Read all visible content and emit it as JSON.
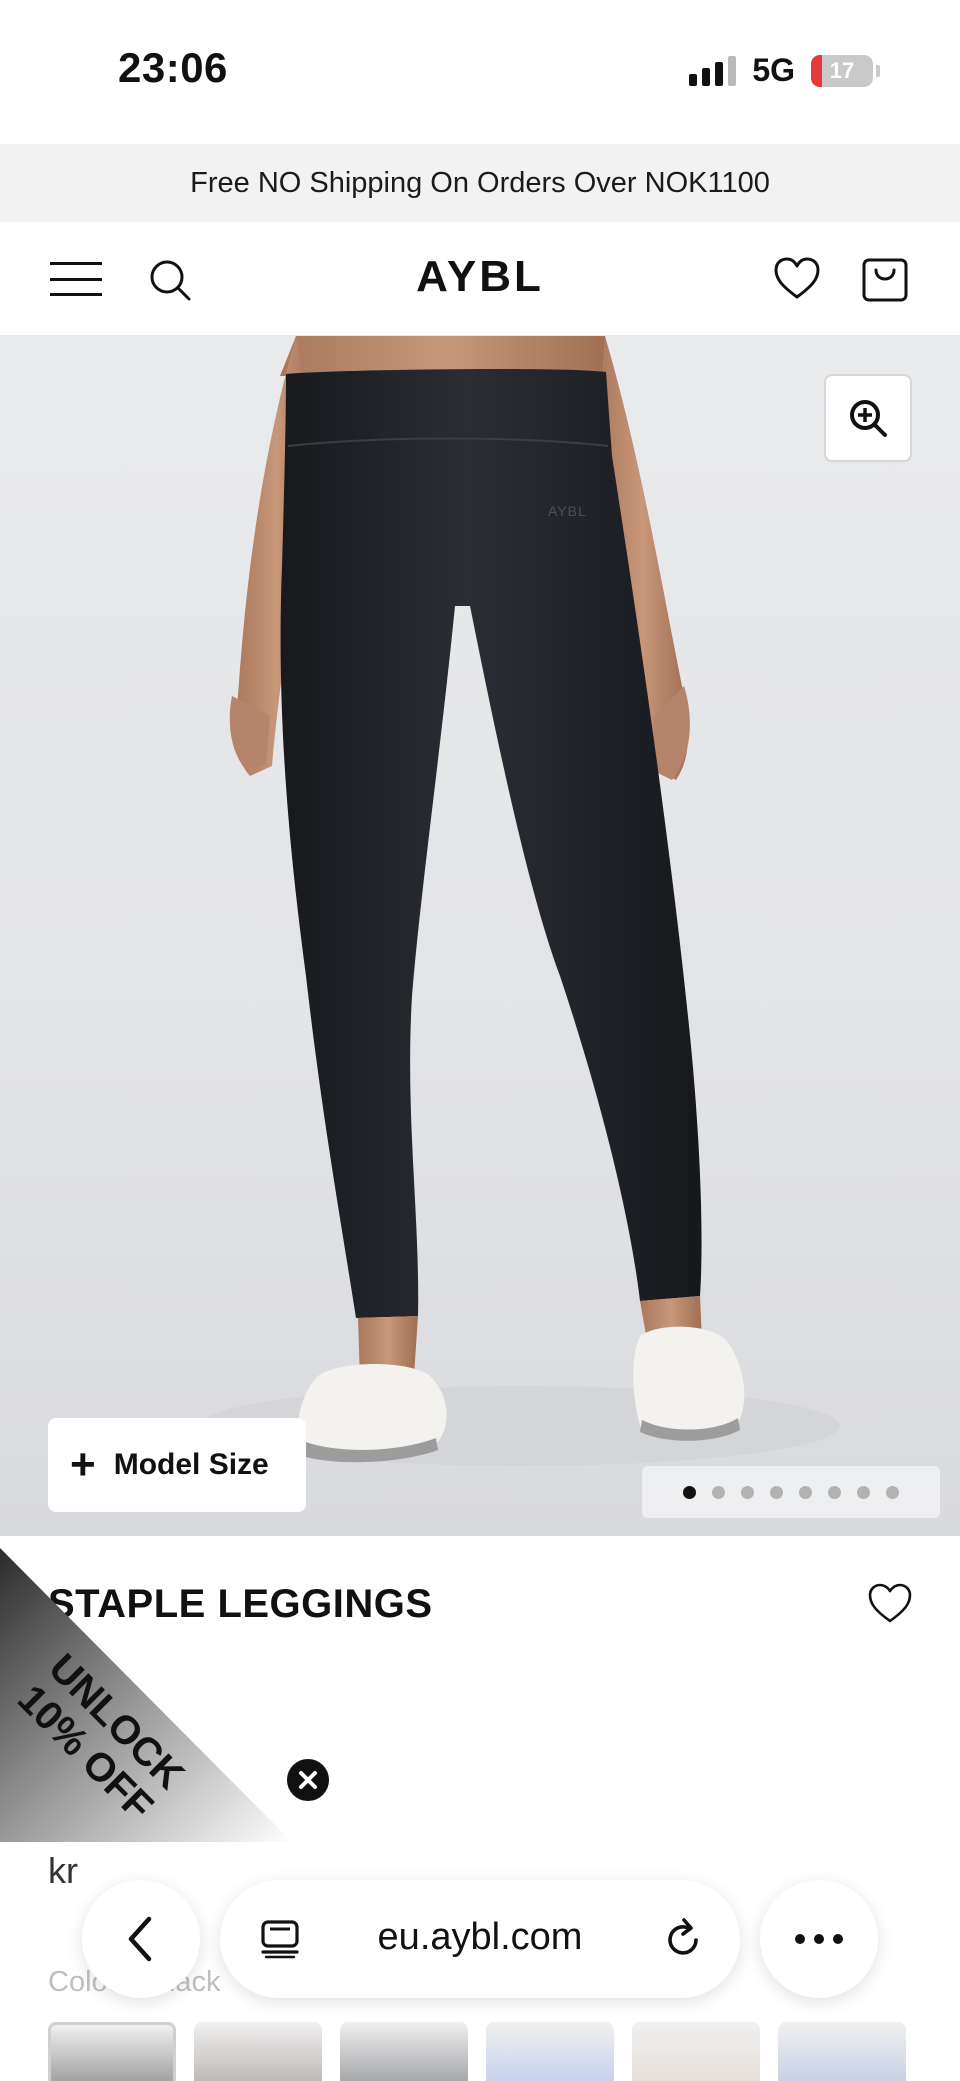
{
  "status_bar": {
    "time": "23:06",
    "network": "5G",
    "battery": "17",
    "battery_level": 0.17
  },
  "announcement": {
    "text": "Free NO Shipping On Orders Over NOK1100"
  },
  "header": {
    "menu_icon": "hamburger-icon",
    "search_icon": "search-icon",
    "logo": "AYBL",
    "wishlist_icon": "heart-icon",
    "bag_icon": "shopping-bag-icon"
  },
  "hero": {
    "zoom_icon": "zoom-in-icon",
    "garment_logo": "AYBL",
    "model_size": {
      "plus": "+",
      "label": "Model Size"
    },
    "carousel": {
      "total": 8,
      "active": 1
    }
  },
  "product": {
    "title": "STAPLE LEGGINGS",
    "price": "kr",
    "colour_label": "Colour: Black",
    "swatch_colors": [
      "#2a2b2e",
      "#6b5e58",
      "#2f3238",
      "#7f9ad6",
      "#c7b9a8",
      "#7f96c7"
    ]
  },
  "promo": {
    "line1": "UNLOCK",
    "line2": "10% OFF",
    "close_icon": "close-icon"
  },
  "browser": {
    "url": "eu.aybl.com",
    "back_icon": "chevron-left-icon",
    "tabs_icon": "tabs-icon",
    "reload_icon": "reload-icon",
    "more_icon": "more-icon"
  }
}
